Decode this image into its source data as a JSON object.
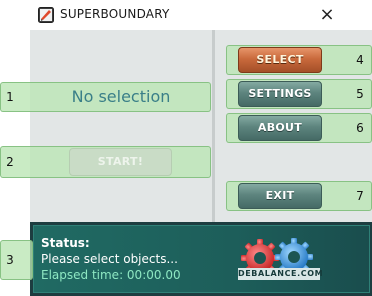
{
  "window": {
    "title": "SUPERBOUNDARY",
    "close_glyph": "×",
    "icon": "app-logo-icon"
  },
  "main": {
    "selection_text": "No selection",
    "start_label": "START!"
  },
  "buttons": {
    "select": "SELECT",
    "settings": "SETTINGS",
    "about": "ABOUT",
    "exit": "EXIT"
  },
  "status": {
    "title": "Status:",
    "message": "Please select objects...",
    "elapsed": "Elapsed time: 00:00.00",
    "logo_text": "DEBALANCE.COM"
  },
  "annotations": [
    "1",
    "2",
    "3",
    "4",
    "5",
    "6",
    "7"
  ],
  "colors": {
    "panel_bg": "#e2e6e6",
    "annotation_overlay": "#bae5b4",
    "select_button": "#c96a3c",
    "teal_button": "#5d847e",
    "status_bg": "#1d5e5a",
    "elapsed_text": "#8de7c2",
    "gear_red": "#e23c3c",
    "gear_blue": "#3ca0e8"
  }
}
